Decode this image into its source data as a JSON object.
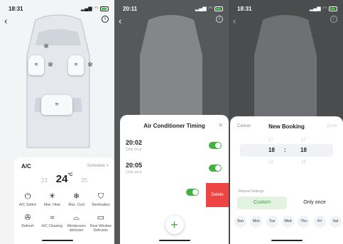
{
  "screen1": {
    "time": "18:31",
    "ac": {
      "title": "A/C",
      "schedule_label": "Schedule >",
      "temp_low": "23",
      "temp_current": "24",
      "temp_unit": "°C",
      "temp_high": "25"
    },
    "controls": [
      {
        "label": "A/C Switch",
        "icon": "power-icon"
      },
      {
        "label": "Max. Heat",
        "icon": "sun-icon"
      },
      {
        "label": "Max. Cool",
        "icon": "snowflake-icon"
      },
      {
        "label": "Sterilisation",
        "icon": "shield-icon"
      },
      {
        "label": "Refresh",
        "icon": "refresh-fan-icon"
      },
      {
        "label": "A/C Cleaning",
        "icon": "wind-icon"
      },
      {
        "label": "Windscreen defroster",
        "icon": "front-defrost-icon"
      },
      {
        "label": "Rear Window Defroster",
        "icon": "rear-defrost-icon"
      }
    ]
  },
  "screen2": {
    "time": "20:11",
    "sheet_title": "Air Conditioner Timing",
    "timers": [
      {
        "time": "20:02",
        "repeat": "Only once",
        "enabled": true
      },
      {
        "time": "20:05",
        "repeat": "Only once",
        "enabled": true
      }
    ],
    "delete_label": "Delete",
    "add_label": "+"
  },
  "screen3": {
    "time": "18:31",
    "cancel_label": "Cancel",
    "title": "New Booking",
    "done_label": "Done",
    "picker": {
      "hour_above": "17",
      "minute_above": "17",
      "hour": "18",
      "minute": "18",
      "hour_below": "19",
      "minute_below": "19"
    },
    "repeat_label": "Repeat Settings",
    "options": [
      "Custom",
      "Only once"
    ],
    "selected_option": "Custom",
    "days": [
      "Sun",
      "Mon",
      "Tue",
      "Wed",
      "Thu",
      "Fri",
      "Sat"
    ]
  },
  "colors": {
    "accent_green": "#45b045",
    "delete_red": "#ee4444"
  }
}
